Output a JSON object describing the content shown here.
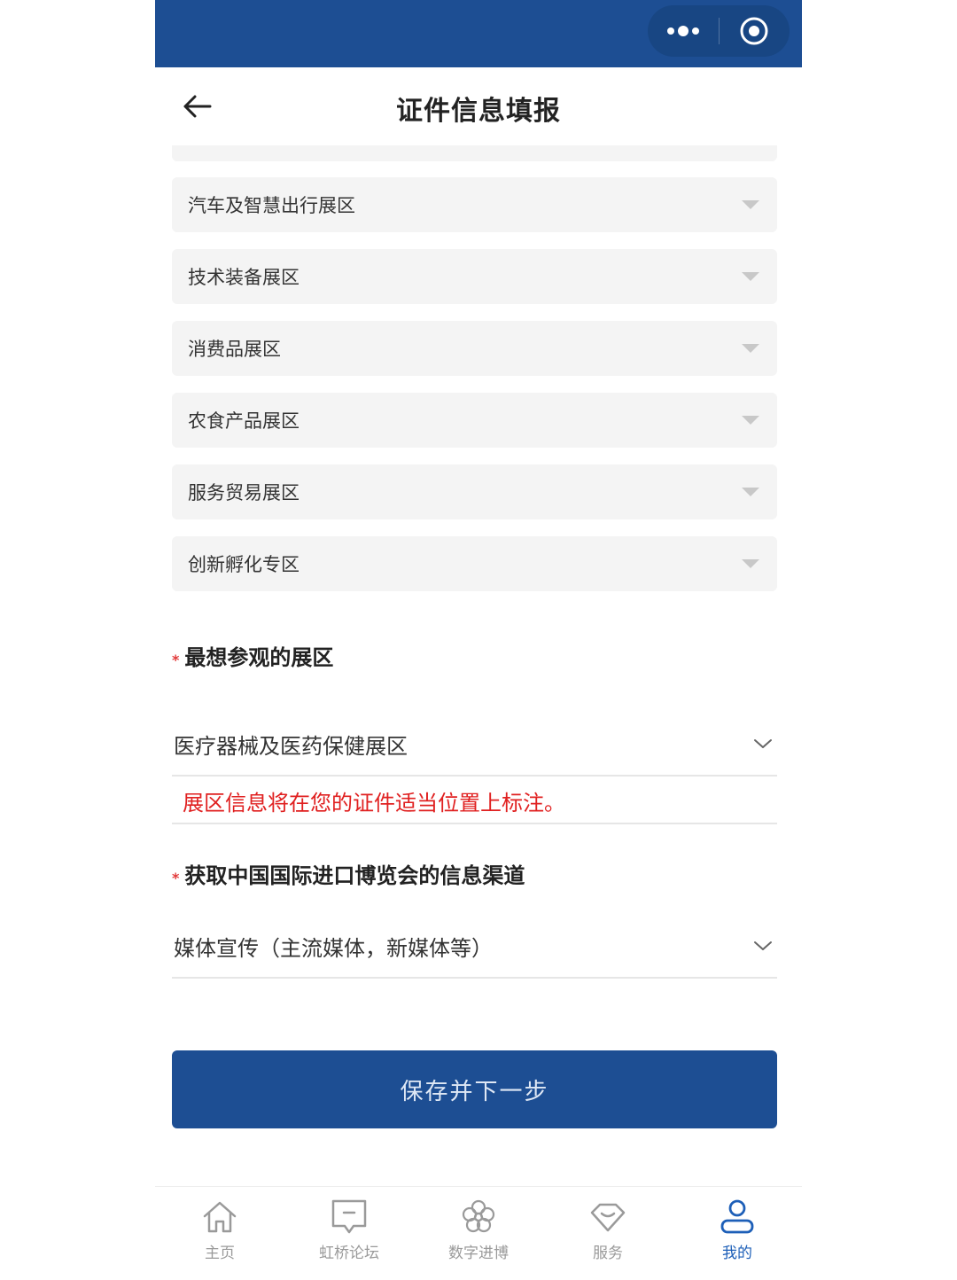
{
  "header": {
    "title": "证件信息填报"
  },
  "hall_options": [
    {
      "label": "汽车及智慧出行展区"
    },
    {
      "label": "技术装备展区"
    },
    {
      "label": "消费品展区"
    },
    {
      "label": "农食产品展区"
    },
    {
      "label": "服务贸易展区"
    },
    {
      "label": "创新孵化专区"
    }
  ],
  "favorite_hall": {
    "required_mark": "*",
    "label": "最想参观的展区",
    "value": "医疗器械及医药保健展区",
    "note": "展区信息将在您的证件适当位置上标注。"
  },
  "info_channel": {
    "required_mark": "*",
    "label": "获取中国国际进口博览会的信息渠道",
    "value": "媒体宣传（主流媒体，新媒体等）"
  },
  "submit_label": "保存并下一步",
  "tabs": [
    {
      "label": "主页"
    },
    {
      "label": "虹桥论坛"
    },
    {
      "label": "数字进博"
    },
    {
      "label": "服务"
    },
    {
      "label": "我的"
    }
  ],
  "colors": {
    "brand": "#1d4e93",
    "required": "#e23a3a",
    "note": "#e02020",
    "active_tab": "#1d5fb8"
  }
}
